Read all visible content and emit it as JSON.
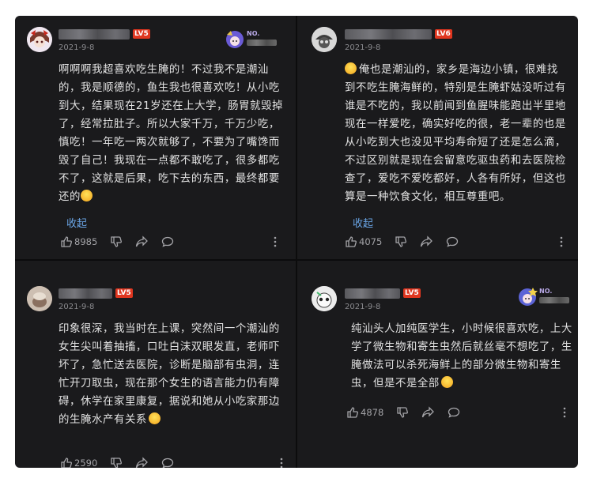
{
  "comments": [
    {
      "level": "LV5",
      "date": "2021-9-8",
      "badge_no": "NO.",
      "lines": [
        "啊啊啊我超喜欢吃生腌的！不过我不是潮汕",
        "的，我是顺德的，鱼生我也很喜欢吃！从小吃",
        "到大，结果现在21岁还在上大学，肠胃就毁掉",
        "了，经常拉肚子。所以大家千万，千万少吃，",
        "慎吃！一年吃一两次就够了，不要为了嘴馋而",
        "毁了自己！我现在一点都不敢吃了，很多都吃",
        "不了，这就是后果，吃下去的东西，最终都要",
        "还的"
      ],
      "collapse": "收起",
      "likes": "8985"
    },
    {
      "level": "LV6",
      "date": "2021-9-8",
      "lines": [
        "俺也是潮汕的，家乡是海边小镇，很难找",
        "到不吃生腌海鲜的，特别是生腌虾姑没听过有",
        "谁是不吃的，我以前闻到鱼腥味能跑出半里地",
        "现在一样爱吃，确实好吃的很，老一辈的也是",
        "从小吃到大也没见平均寿命短了还是怎么滴，",
        "不过区别就是现在会留意吃驱虫药和去医院检",
        "查了，爱吃不爱吃都好，人各有所好，但这也",
        "算是一种饮食文化，相互尊重吧。"
      ],
      "collapse": "收起",
      "likes": "4075"
    },
    {
      "level": "LV5",
      "date": "2021-9-8",
      "lines": [
        "印象很深，我当时在上课，突然间一个潮汕的",
        "女生尖叫着抽搐，口吐白沫双眼发直，老师吓",
        "坏了，急忙送去医院，诊断是脑部有虫洞，连",
        "忙开刀取虫，现在那个女生的语言能力仍有障",
        "碍，休学在家里康复，据说和她从小吃家那边",
        "的生腌水产有关系"
      ],
      "likes": "2590"
    },
    {
      "level": "LV5",
      "date": "2021-9-8",
      "badge_no": "NO.",
      "lines": [
        "纯汕头人加纯医学生，小时候很喜欢吃，上大",
        "学了微生物和寄生虫然后就丝毫不想吃了，生",
        "腌做法可以杀死海鲜上的部分微生物和寄生",
        "虫，但是不是全部"
      ],
      "likes": "4878"
    }
  ],
  "icons": {
    "like": "thumb-up-icon",
    "dislike": "thumb-down-icon",
    "share": "share-icon",
    "reply": "comment-icon",
    "more": "more-vertical-icon"
  },
  "colors": {
    "background": "#1a1a1c",
    "text": "#e2e2e2",
    "meta": "#8a8a8e",
    "level_badge": "#e0361f",
    "collapse_link": "#6aa5e6"
  }
}
